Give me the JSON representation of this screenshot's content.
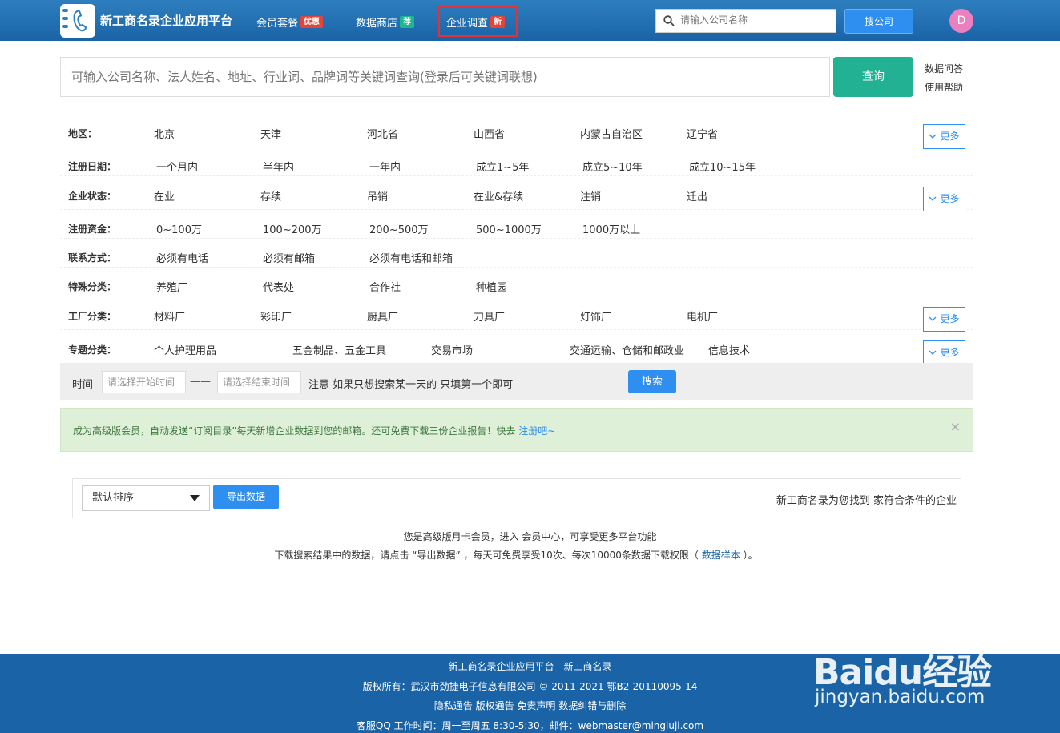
{
  "header": {
    "logo_text": "新工商名录企业应用平台",
    "nav": [
      {
        "label": "会员套餐",
        "badge": "优惠",
        "badge_color": "#e3453a"
      },
      {
        "label": "数据商店",
        "badge": "荐",
        "badge_color": "#1fb58f"
      },
      {
        "label": "企业调查",
        "badge": "新",
        "badge_color": "#e3453a"
      }
    ],
    "search_placeholder": "请输入公司名称",
    "search_button": "搜公司",
    "avatar_letter": "D"
  },
  "main_search": {
    "placeholder": "可输入公司名称、法人姓名、地址、行业词、品牌词等关键词查询(登录后可关键词联想)",
    "button": "查询",
    "links": [
      "数据问答",
      "使用帮助"
    ]
  },
  "filters": [
    {
      "label": "地区：",
      "options": [
        "北京",
        "天津",
        "河北省",
        "山西省",
        "内蒙古自治区",
        "辽宁省"
      ],
      "more": "更多"
    },
    {
      "label": "注册日期：",
      "options": [
        "一个月内",
        "半年内",
        "一年内",
        "成立1~5年",
        "成立5~10年",
        "成立10~15年"
      ],
      "more": ""
    },
    {
      "label": "企业状态：",
      "options": [
        "在业",
        "存续",
        "吊销",
        "在业&存续",
        "注销",
        "迁出"
      ],
      "more": "更多"
    },
    {
      "label": "注册资金：",
      "options": [
        "0~100万",
        "100~200万",
        "200~500万",
        "500~1000万",
        "1000万以上"
      ],
      "more": ""
    },
    {
      "label": "联系方式：",
      "options": [
        "必须有电话",
        "必须有邮箱",
        "必须有电话和邮箱"
      ],
      "more": ""
    },
    {
      "label": "特殊分类：",
      "options": [
        "养殖厂",
        "代表处",
        "合作社",
        "种植园"
      ],
      "more": ""
    },
    {
      "label": "工厂分类：",
      "options": [
        "材料厂",
        "彩印厂",
        "厨具厂",
        "刀具厂",
        "灯饰厂",
        "电机厂"
      ],
      "more": "更多"
    },
    {
      "label": "专题分类：",
      "options": [
        "个人护理用品",
        "五金制品、五金工具",
        "交易市场",
        "交通运输、仓储和邮政业",
        "信息技术"
      ],
      "more": "更多"
    }
  ],
  "time_filter": {
    "label": "时间",
    "start_placeholder": "请选择开始时间",
    "separator": "——",
    "end_placeholder": "请选择结束时间",
    "note": "注意 如果只想搜索某一天的 只填第一个即可",
    "button": "搜索"
  },
  "alert": {
    "text": "成为高级版会员，自动发送“订阅目录”每天新增企业数据到您的邮箱。还可免费下载三份企业报告！快去 ",
    "link": "注册吧~",
    "close": "×"
  },
  "results": {
    "sort_value": "默认排序",
    "export_button": "导出数据",
    "summary": "新工商名录为您找到 家符合条件的企业"
  },
  "info": {
    "line1": "您是高级版月卡会员，进入 会员中心，可享受更多平台功能",
    "line2_prefix": "下载搜索结果中的数据，请点击 “导出数据” ，每天可免费享受10次、每次10000条数据下载权限（ ",
    "line2_link": "数据样本",
    "line2_suffix": " ）。"
  },
  "footer": {
    "line1": "新工商名录企业应用平台 - 新工商名录",
    "line2": "版权所有：武汉市劲捷电子信息有限公司 © 2011-2021 鄂B2-20110095-14",
    "line3": "隐私通告 版权通告 免责声明 数据纠错与删除",
    "line4": "客服QQ  工作时间：周一至周五 8:30-5:30，邮件：webmaster@mingluji.com"
  },
  "watermark": {
    "brand": "Baidu经验",
    "url": "jingyan.baidu.com"
  },
  "colors": {
    "header": "#1a63a6",
    "accent": "#2f8ff0",
    "query": "#23b193",
    "highlight_box": "#e3303a"
  }
}
